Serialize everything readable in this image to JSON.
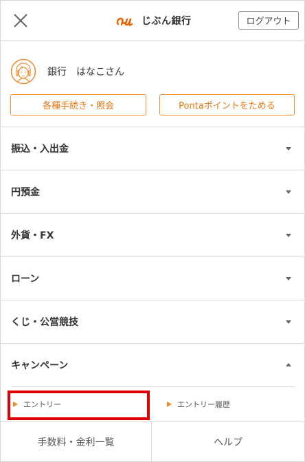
{
  "header": {
    "logo_text": "じぶん銀行",
    "logout_label": "ログアウト"
  },
  "user": {
    "name": "銀行　はなこさん"
  },
  "actions": {
    "procedures_label": "各種手続き・照会",
    "ponta_label": "Pontaポイントをためる"
  },
  "menu": {
    "items": [
      {
        "label": "振込・入出金",
        "expanded": false
      },
      {
        "label": "円預金",
        "expanded": false
      },
      {
        "label": "外貨・FX",
        "expanded": false
      },
      {
        "label": "ローン",
        "expanded": false
      },
      {
        "label": "くじ・公営競技",
        "expanded": false
      },
      {
        "label": "キャンペーン",
        "expanded": true
      }
    ]
  },
  "campaign": {
    "sub_items": [
      {
        "label": "エントリー"
      },
      {
        "label": "エントリー履歴"
      }
    ]
  },
  "bottom": {
    "fees_label": "手数料・金利一覧",
    "help_label": "ヘルプ"
  },
  "colors": {
    "accent": "#f08a2c",
    "highlight": "#e00000",
    "divider": "#dcdcdc"
  },
  "icons": {
    "close": "close-icon",
    "chevron": "chevron-down-icon",
    "chevron_up": "chevron-up-icon",
    "triangle": "triangle-right-icon",
    "avatar": "avatar-icon"
  }
}
